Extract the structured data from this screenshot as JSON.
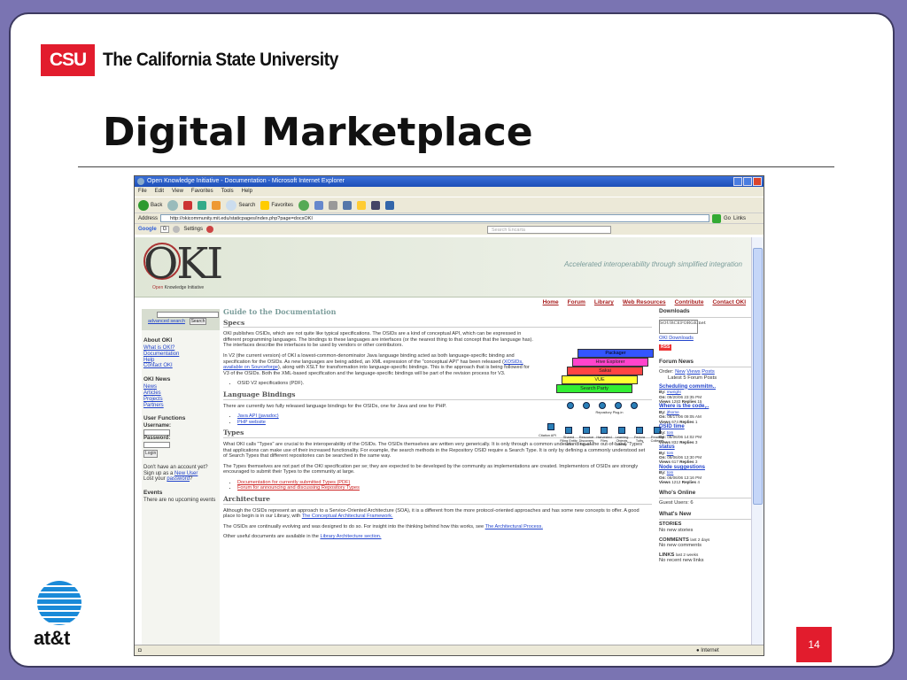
{
  "slide": {
    "csu_logo": "CSU",
    "university_name": "The California State University",
    "title": "Digital Marketplace",
    "sponsor_logo_text": "at&t",
    "page_number": "14"
  },
  "browser": {
    "window_title": "Open Knowledge Initiative - Documentation - Microsoft Internet Explorer",
    "menu": [
      "File",
      "Edit",
      "View",
      "Favorites",
      "Tools",
      "Help"
    ],
    "toolbar": {
      "back": "Back",
      "search": "Search",
      "favorites": "Favorites"
    },
    "address_label": "Address",
    "address_url": "http://okicommunity.mit.edu/staticpages/index.php?page=docsOKI",
    "go_label": "Go",
    "links_label": "Links",
    "google_label": "Google",
    "google_box": "G",
    "settings_label": "Settings",
    "search_placeholder": "Search Encarta",
    "status_zone": "Internet"
  },
  "oki": {
    "logo": "OKI",
    "logo_caption_colored": "Open",
    "logo_caption": "Knowledge Initiative",
    "tagline": "Accelerated interoperability through simplified integration",
    "nav": [
      "Home",
      "Forum",
      "Library",
      "Web Resources",
      "Contribute",
      "Contact OKI"
    ]
  },
  "left": {
    "advanced_search": "advanced search",
    "search_button": "Search",
    "about_heading": "About OKI",
    "about_links": [
      "What is OKI?",
      "Documentation",
      "Help",
      "Contact OKI"
    ],
    "news_heading": "OKI News",
    "news_links": [
      "News",
      "Articles",
      "Projects",
      "Partners"
    ],
    "user_heading": "User Functions",
    "username_label": "Username:",
    "password_label": "Password:",
    "login_button": "Login",
    "account_line1": "Don't have an account yet?",
    "account_line2_prefix": "Sign up as a",
    "account_line2_link": "New User",
    "account_line3_prefix": "Lost your",
    "account_line3_link": "password",
    "account_line3_suffix": "?",
    "events_heading": "Events",
    "events_text": "There are no upcoming events"
  },
  "main": {
    "guide_title": "Guide to the Documentation",
    "specs_heading": "Specs",
    "specs_p1": "OKI publishes OSIDs, which are not quite like typical specifications. The OSIDs are a kind of conceptual API, which can be expressed in different programming languages. The bindings to these languages are interfaces (or the nearest thing to that concept that the language has). The interfaces describe the interfaces to be used by vendors or other contributors.",
    "specs_p2_a": "In V2 (the current version) of OKI a lowest-common-denominator Java language binding acted as both language-specific binding and specification for the OSIDs. As new languages are being added, an XML expression of the \"conceptual API\" has been released (",
    "specs_p2_link": "XOSIDs, available on Sourceforge",
    "specs_p2_b": "), along with XSLT for transformation into language-specific bindings. This is the approach that is being followed for V3 of the OSIDs. Both the XML-based specification and the language-specific bindings will be part of the revision process for V3.",
    "specs_bullet": "OSID V2 specifications (PDF).",
    "lang_heading": "Language Bindings",
    "lang_p": "There are currently two fully released language bindings for the OSIDs, one for Java and one for PHP.",
    "lang_links": [
      "Java API (javadoc)",
      "PHP website"
    ],
    "types_heading": "Types",
    "types_p1": "What OKI calls \"Types\" are crucial to the interoperability of the OSIDs. The OSIDs themselves are written very generically. It is only through a common understanding of the out-of-band \"Types\" that applications can make use of their increased functionality. For example, the search methods in the Repository OSID require a Search Type. It is only by defining a commonly understood set of Search Types that different repositories can be searched in the same way.",
    "types_p2": "The Types themselves are not part of the OKI specification per se; they are expected to be developed by the community as implementations are created. Implementors of OSIDs are strongly encouraged to submit their Types to the community at large.",
    "types_links": [
      "Documentation for currently submitted Types (PDF)",
      "Forum for announcing and discussing Repository Types"
    ],
    "arch_heading": "Architecture",
    "arch_p1_a": "Although the OSIDs represent an approach to a Service-Oriented Architecture (SOA), it is a different from the more protocol-oriented approaches and has some new concepts to offer. A good place to begin is in our Library, with ",
    "arch_p1_link": "The Conceptual Architectural Framework.",
    "arch_p2_a": "The OSIDs are continually evolving and was designed to do so. For insight into the thinking behind how this works, see ",
    "arch_p2_link": "The Architectural Process.",
    "arch_p3_a": "Other useful documents are available in the ",
    "arch_p3_link": "Library Architecture section."
  },
  "diagram": {
    "layers": [
      {
        "label": "Packager",
        "color": "#3355ff"
      },
      {
        "label": "Hive Explorer",
        "color": "#ff44cc"
      },
      {
        "label": "Sakai",
        "color": "#ff4444"
      },
      {
        "label": "VUE",
        "color": "#ffff33"
      },
      {
        "label": "Search Party",
        "color": "#33ee33"
      }
    ],
    "small_labels": [
      "Repository Plug-in",
      "Citation API",
      "Shared Filing Entity API",
      "Resource Discovery Network",
      "Harvested Files",
      "Learning Objects Library",
      "Fedora Tufts",
      "Reading Colleges"
    ]
  },
  "right": {
    "downloads_heading": "Downloads",
    "sourceforge_text": "SOURCEFORGE.net",
    "oki_downloads": "OKI Downloads",
    "rss": "RSS",
    "forum_heading": "Forum News",
    "order_prefix": "Order:",
    "order_links": [
      "New",
      "Views",
      "Posts"
    ],
    "latest_posts": "Latest 5 Forum Posts",
    "posts": [
      {
        "title": "Scheduling commitm..",
        "by": "mwright",
        "on": "08/20/06 23:35 PM",
        "views": "1283",
        "replies": "15"
      },
      {
        "title": "Where is the code,..",
        "by": "jthorne",
        "on": "08/17/06 09:05 AM",
        "views": "674",
        "replies": "1"
      },
      {
        "title": "OSID time",
        "by": "tom",
        "on": "08/06/06 14:02 PM",
        "views": "832",
        "replies": "3"
      },
      {
        "title": "status",
        "by": "tom",
        "on": "08/06/06 13:30 PM",
        "views": "617",
        "replies": "3"
      },
      {
        "title": "Node suggestions",
        "by": "tom",
        "on": "08/06/06 13:16 PM",
        "views": "1212",
        "replies": "4"
      }
    ],
    "by_label": "By:",
    "on_label": "On:",
    "views_label": "Views",
    "replies_label": "Replies",
    "online_heading": "Who's Online",
    "guest_users": "Guest Users: 6",
    "whatsnew_heading": "What's New",
    "stories_label": "STORIES",
    "stories_text": "No new stories",
    "comments_label": "COMMENTS",
    "comments_sub": "last 2 days",
    "comments_text": "No new comments",
    "links_label": "LINKS",
    "links_sub": "last 2 weeks",
    "links_text": "No recent new links"
  }
}
